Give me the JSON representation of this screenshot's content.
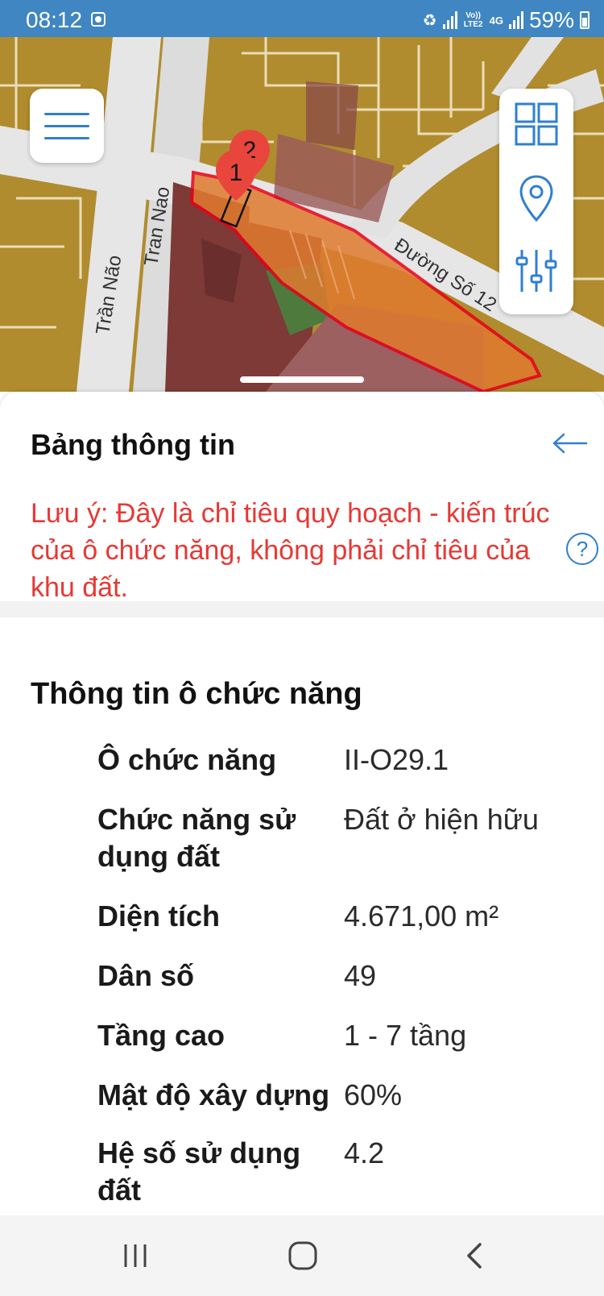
{
  "status_bar": {
    "time": "08:12",
    "network_label": "Vo)) LTE2",
    "network_type": "4G",
    "battery": "59%"
  },
  "map": {
    "roads": [
      "Trần Não",
      "Tran Nao",
      "Đường Số 12"
    ],
    "markers": [
      "1",
      "2"
    ],
    "colors": {
      "land": "#b08c2e",
      "road": "#e6e6e6",
      "parcel_highlight": "#e07a2e",
      "parcel_border": "#e8001a",
      "marker": "#e8463c",
      "residential": "#8a4a4a",
      "green": "#4f7a3d"
    },
    "icons": {
      "menu": "menu-icon",
      "layers": "grid-icon",
      "location": "location-pin-icon",
      "filter": "sliders-icon"
    }
  },
  "panel": {
    "title": "Bảng thông tin",
    "note": "Lưu ý: Đây là chỉ tiêu quy hoạch - kiến trúc của ô chức năng, không phải chỉ tiêu của khu đất.",
    "section_title": "Thông tin ô chức năng",
    "rows": [
      {
        "label": "Ô chức năng",
        "value": "II-O29.1"
      },
      {
        "label": "Chức năng sử dụng đất",
        "value": "Đất ở hiện hữu"
      },
      {
        "label": "Diện tích",
        "value": "4.671,00 m²"
      },
      {
        "label": "Dân số",
        "value": "49"
      },
      {
        "label": "Tầng cao",
        "value": "1 - 7 tầng"
      },
      {
        "label": "Mật độ xây dựng",
        "value": "60%"
      },
      {
        "label": "Hệ số sử dụng đất",
        "value": "4.2"
      }
    ]
  },
  "accent": "#2f7fd0",
  "warning": "#e53935"
}
